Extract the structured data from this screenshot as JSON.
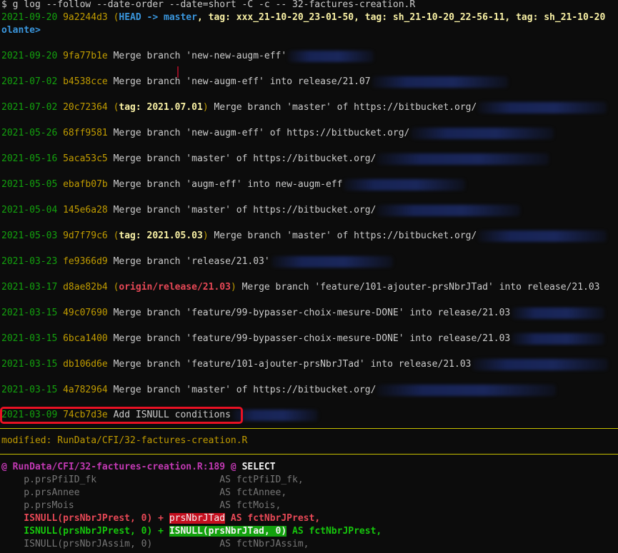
{
  "prompt": "$ ",
  "command": "g log --follow --date-order --date=short -C -c -- 32-factures-creation.R",
  "head_commit": {
    "date": "2021-09-20",
    "hash": "9a2244d3",
    "open": "(",
    "head_ref": "HEAD -> master",
    "tags_text": ", tag: xxx_21-10-20_23-01-50, tag: sh_21-10-20_22-56-11, tag: sh_21-10-20",
    "wrap": "olante>"
  },
  "commits": [
    {
      "date": "2021-09-20",
      "hash": "9fa77b1e",
      "msg": "Merge branch 'new-new-augm-eff'"
    },
    {
      "date": "2021-07-02",
      "hash": "b4538cce",
      "msg": "Merge branch 'new-augm-eff' into release/21.07"
    },
    {
      "date": "2021-07-02",
      "hash": "20c72364",
      "tag": "2021.07.01",
      "msg": "Merge branch 'master' of https://bitbucket.org/"
    },
    {
      "date": "2021-05-26",
      "hash": "68ff9581",
      "msg": "Merge branch 'new-augm-eff' of https://bitbucket.org/"
    },
    {
      "date": "2021-05-16",
      "hash": "5aca53c5",
      "msg": "Merge branch 'master' of https://bitbucket.org/"
    },
    {
      "date": "2021-05-05",
      "hash": "ebafb07b",
      "msg": "Merge branch 'augm-eff' into new-augm-eff"
    },
    {
      "date": "2021-05-04",
      "hash": "145e6a28",
      "msg": "Merge branch 'master' of https://bitbucket.org/"
    },
    {
      "date": "2021-05-03",
      "hash": "9d7f79c6",
      "tag": "2021.05.03",
      "msg": "Merge branch 'master' of https://bitbucket.org/"
    },
    {
      "date": "2021-03-23",
      "hash": "fe9366d9",
      "msg": "Merge branch 'release/21.03'"
    },
    {
      "date": "2021-03-17",
      "hash": "d8ae82b4",
      "ref": "origin/release/21.03",
      "msg": "Merge branch 'feature/101-ajouter-prsNbrJTad' into release/21.03"
    },
    {
      "date": "2021-03-15",
      "hash": "49c07690",
      "msg": "Merge branch 'feature/99-bypasser-choix-mesure-DONE' into release/21.03"
    },
    {
      "date": "2021-03-15",
      "hash": "6bca1400",
      "msg": "Merge branch 'feature/99-bypasser-choix-mesure-DONE' into release/21.03"
    },
    {
      "date": "2021-03-15",
      "hash": "db106d6e",
      "msg": "Merge branch 'feature/101-ajouter-prsNbrJTad' into release/21.03"
    },
    {
      "date": "2021-03-15",
      "hash": "4a782964",
      "msg": "Merge branch 'master' of https://bitbucket.org/"
    }
  ],
  "highlighted_commit": {
    "date": "2021-03-09",
    "hash": "74cb7d3e",
    "msg": "Add ISNULL conditions"
  },
  "modified_label": "modified: RunData/CFI/32-factures-creation.R",
  "hunk": {
    "marker": "@",
    "file": "RunData/CFI/32-factures-creation.R:189",
    "end": "@",
    "context": "SELECT"
  },
  "diff": {
    "c1": "    p.prsPfiID_fk                      AS fctPfiID_fk,",
    "c2": "    p.prsAnnee                         AS fctAnnee,",
    "c3": "    p.prsMois                          AS fctMois,",
    "del_a": "    ISNULL(prsNbrJPrest, 0) + ",
    "del_b": "prsNbrJTad",
    "del_c": " AS fctNbrJPrest,",
    "add_a": "    ISNULL(prsNbrJPrest, 0) + ",
    "add_b": "ISNULL(prsNbrJTad, 0)",
    "add_c": " AS fctNbrJPrest,",
    "c4": "    ISNULL(prsNbrJAssim, 0)            AS fctNbrJAssim,"
  }
}
